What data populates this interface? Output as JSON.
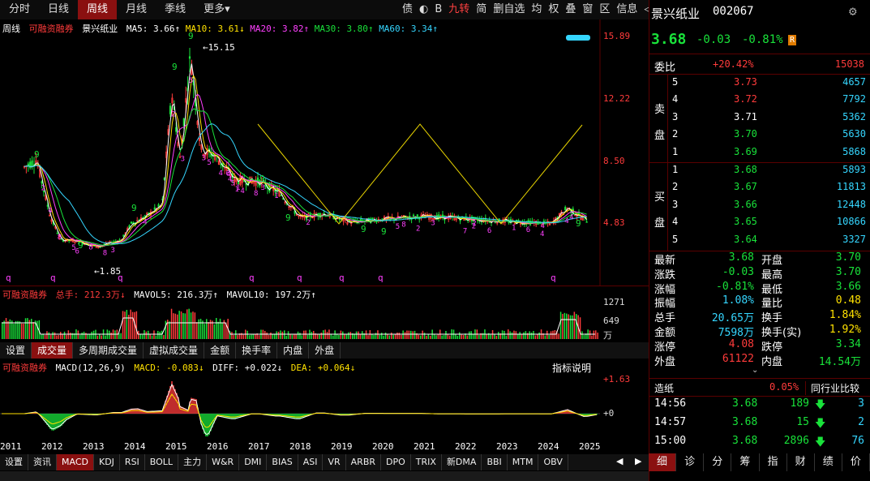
{
  "top_tabs": [
    {
      "label": "分时",
      "active": false
    },
    {
      "label": "日线",
      "active": false
    },
    {
      "label": "周线",
      "active": true
    },
    {
      "label": "月线",
      "active": false
    },
    {
      "label": "季线",
      "active": false
    },
    {
      "label": "更多▾",
      "active": false
    }
  ],
  "top_icons": [
    {
      "label": "债",
      "hi": false
    },
    {
      "label": "◐",
      "hi": false
    },
    {
      "label": "B",
      "hi": false
    },
    {
      "label": "九转",
      "hi": true
    },
    {
      "label": "简",
      "hi": false
    },
    {
      "label": "删自选",
      "hi": false
    },
    {
      "label": "均",
      "hi": false
    },
    {
      "label": "权",
      "hi": false
    },
    {
      "label": "叠",
      "hi": false
    },
    {
      "label": "窗",
      "hi": false
    },
    {
      "label": "区",
      "hi": false
    },
    {
      "label": "信息",
      "hi": false
    },
    {
      "label": "◁",
      "hi": false
    },
    {
      "label": "▷",
      "hi": false
    }
  ],
  "main_legend": {
    "period": "周线",
    "rzrq": "可融资融券",
    "name": "景兴纸业",
    "ma5": "MA5: 3.66↑",
    "ma10": "MA10: 3.61↓",
    "ma20": "MA20: 3.82↑",
    "ma30": "MA30: 3.80↑",
    "ma60": "MA60: 3.34↑"
  },
  "price_axis": [
    "15.89",
    "12.22",
    "8.50",
    "4.83"
  ],
  "high_label": "15.15",
  "low_label": "1.85",
  "vol_legend": {
    "rzrq": "可融资融券",
    "total": "总手: 212.3万↓",
    "mavol5": "MAVOL5: 216.3万↑",
    "mavol10": "MAVOL10: 197.2万↑"
  },
  "vol_axis": [
    "1271",
    "649",
    "万"
  ],
  "mid_tabs": [
    {
      "label": "设置",
      "active": false
    },
    {
      "label": "成交量",
      "active": true
    },
    {
      "label": "多周期成交量",
      "active": false
    },
    {
      "label": "虚拟成交量",
      "active": false
    },
    {
      "label": "金额",
      "active": false
    },
    {
      "label": "换手率",
      "active": false
    },
    {
      "label": "内盘",
      "active": false
    },
    {
      "label": "外盘",
      "active": false
    }
  ],
  "macd_legend": {
    "rzrq": "可融资融券",
    "macd_name": "MACD(12,26,9)",
    "macd": "MACD: -0.083↓",
    "diff": "DIFF: +0.022↓",
    "dea": "DEA: +0.064↓",
    "explain": "指标说明"
  },
  "macd_axis": [
    "+1.63",
    "+0"
  ],
  "years": [
    "2011",
    "2012",
    "2013",
    "2014",
    "2015",
    "2016",
    "2017",
    "2018",
    "2019",
    "2020",
    "2021",
    "2022",
    "2023",
    "2024",
    "2025"
  ],
  "bottom_tabs": [
    {
      "label": "设置",
      "active": false
    },
    {
      "label": "资讯",
      "active": false
    },
    {
      "label": "MACD",
      "active": true
    },
    {
      "label": "KDJ",
      "active": false
    },
    {
      "label": "RSI",
      "active": false
    },
    {
      "label": "BOLL",
      "active": false
    },
    {
      "label": "主力",
      "active": false
    },
    {
      "label": "W&R",
      "active": false
    },
    {
      "label": "DMI",
      "active": false
    },
    {
      "label": "BIAS",
      "active": false
    },
    {
      "label": "ASI",
      "active": false
    },
    {
      "label": "VR",
      "active": false
    },
    {
      "label": "ARBR",
      "active": false
    },
    {
      "label": "DPO",
      "active": false
    },
    {
      "label": "TRIX",
      "active": false
    },
    {
      "label": "新DMA",
      "active": false
    },
    {
      "label": "BBI",
      "active": false
    },
    {
      "label": "MTM",
      "active": false
    },
    {
      "label": "OBV",
      "active": false
    }
  ],
  "quote": {
    "name": "景兴纸业",
    "code": "002067",
    "price": "3.68",
    "change": "-0.03",
    "pct": "-0.81%",
    "r_badge": "R",
    "weibi_label": "委比",
    "weibi_pct": "+20.42%",
    "weibi_diff": "15038",
    "sell_label": [
      "卖",
      "盘"
    ],
    "buy_label": [
      "买",
      "盘"
    ],
    "sells": [
      {
        "lvl": "5",
        "price": "3.73",
        "vol": "4657",
        "color": "red"
      },
      {
        "lvl": "4",
        "price": "3.72",
        "vol": "7792",
        "color": "red"
      },
      {
        "lvl": "3",
        "price": "3.71",
        "vol": "5362",
        "color": "white"
      },
      {
        "lvl": "2",
        "price": "3.70",
        "vol": "5630",
        "color": "green"
      },
      {
        "lvl": "1",
        "price": "3.69",
        "vol": "5868",
        "color": "green"
      }
    ],
    "buys": [
      {
        "lvl": "1",
        "price": "3.68",
        "vol": "5893",
        "color": "green"
      },
      {
        "lvl": "2",
        "price": "3.67",
        "vol": "11813",
        "color": "green"
      },
      {
        "lvl": "3",
        "price": "3.66",
        "vol": "12448",
        "color": "green"
      },
      {
        "lvl": "4",
        "price": "3.65",
        "vol": "10866",
        "color": "green"
      },
      {
        "lvl": "5",
        "price": "3.64",
        "vol": "3327",
        "color": "green"
      }
    ],
    "stats": [
      {
        "l1": "最新",
        "v1": "3.68",
        "c1": "green",
        "l2": "开盘",
        "v2": "3.70",
        "c2": "green"
      },
      {
        "l1": "涨跌",
        "v1": "-0.03",
        "c1": "green",
        "l2": "最高",
        "v2": "3.70",
        "c2": "green"
      },
      {
        "l1": "涨幅",
        "v1": "-0.81%",
        "c1": "green",
        "l2": "最低",
        "v2": "3.66",
        "c2": "green"
      },
      {
        "l1": "振幅",
        "v1": "1.08%",
        "c1": "cyan",
        "l2": "量比",
        "v2": "0.48",
        "c2": "yellow"
      },
      {
        "l1": "总手",
        "v1": "20.65万",
        "c1": "cyan",
        "l2": "换手",
        "v2": "1.84%",
        "c2": "yellow"
      },
      {
        "l1": "金额",
        "v1": "7598万",
        "c1": "cyan",
        "l2": "换手(实)",
        "v2": "1.92%",
        "c2": "yellow"
      },
      {
        "l1": "涨停",
        "v1": "4.08",
        "c1": "red",
        "l2": "跌停",
        "v2": "3.34",
        "c2": "green"
      },
      {
        "l1": "外盘",
        "v1": "61122",
        "c1": "red",
        "l2": "内盘",
        "v2": "14.54万",
        "c2": "green"
      }
    ],
    "industry": "造纸",
    "industry_pct": "0.05%",
    "industry_btn": "同行业比较",
    "ticks": [
      {
        "time": "14:56",
        "price": "3.68",
        "vol": "189",
        "n": "3"
      },
      {
        "time": "14:57",
        "price": "3.68",
        "vol": "15",
        "n": "2"
      },
      {
        "time": "15:00",
        "price": "3.68",
        "vol": "2896",
        "n": "76"
      }
    ]
  },
  "bottom_nav": [
    {
      "label": "细",
      "active": true
    },
    {
      "label": "诊",
      "active": false
    },
    {
      "label": "分",
      "active": false
    },
    {
      "label": "筹",
      "active": false
    },
    {
      "label": "指",
      "active": false
    },
    {
      "label": "财",
      "active": false
    },
    {
      "label": "绩",
      "active": false
    },
    {
      "label": "价",
      "active": false
    }
  ],
  "colors": {
    "up": "#ff3b3b",
    "down": "#19e23a",
    "accent": "#8a1010",
    "ma5": "#ffffff",
    "ma10": "#ffe100",
    "ma20": "#ff40ff",
    "ma30": "#19e23a",
    "ma60": "#35d6ff"
  }
}
